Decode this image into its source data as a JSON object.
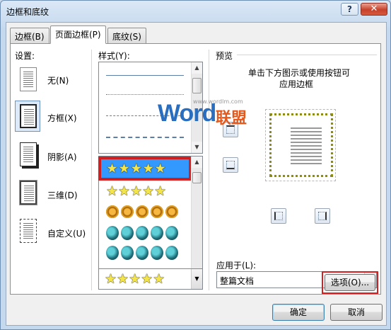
{
  "window": {
    "title": "边框和底纹",
    "help_label": "?",
    "close_label": "✕"
  },
  "tabs": [
    {
      "label": "边框(B)"
    },
    {
      "label": "页面边框(P)"
    },
    {
      "label": "底纹(S)"
    }
  ],
  "settings": {
    "heading": "设置:",
    "items": [
      {
        "label": "无(N)",
        "icon": "no-border-icon"
      },
      {
        "label": "方框(X)",
        "icon": "box-border-icon"
      },
      {
        "label": "阴影(A)",
        "icon": "shadow-border-icon"
      },
      {
        "label": "三维(D)",
        "icon": "3d-border-icon"
      },
      {
        "label": "自定义(U)",
        "icon": "custom-border-icon"
      }
    ],
    "selected": "方框(X)"
  },
  "style": {
    "heading": "样式(Y):"
  },
  "art": {
    "star_row": "★★★★★"
  },
  "preview": {
    "heading": "预览",
    "hint_line1": "单击下方图示或使用按钮可",
    "hint_line2": "应用边框"
  },
  "apply_to": {
    "label": "应用于(L):",
    "value": "整篇文档"
  },
  "buttons": {
    "options": "选项(O)...",
    "ok": "确定",
    "cancel": "取消"
  },
  "watermark": {
    "small": "www.wordlm.com",
    "brand": "Word",
    "cn": "联盟"
  },
  "colors": {
    "selection": "#3399ff",
    "highlight": "#d42020",
    "star": "#f2e44a"
  }
}
